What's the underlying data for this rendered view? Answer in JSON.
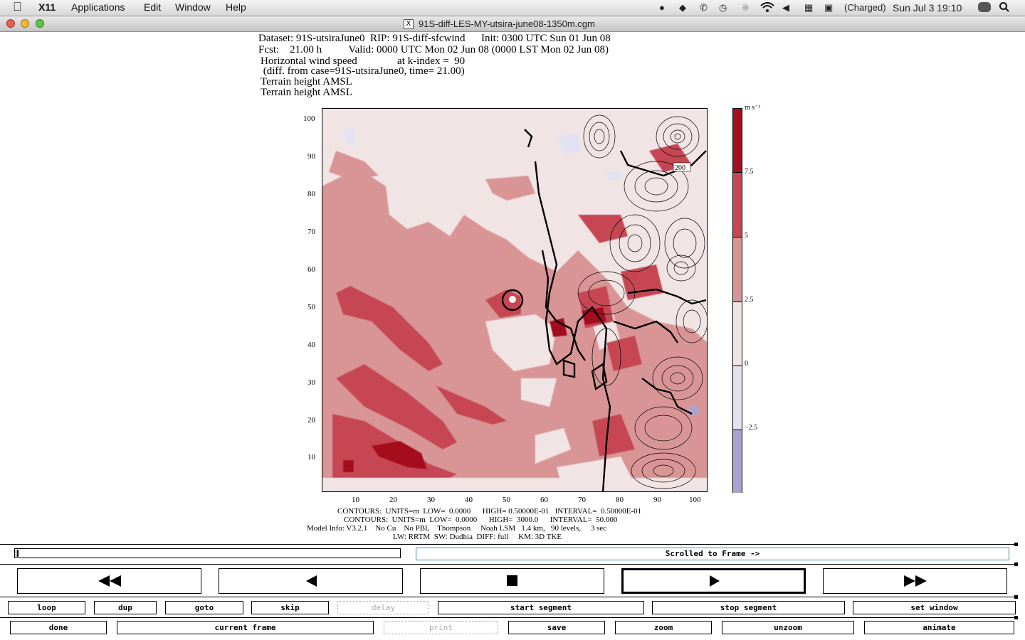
{
  "menubar": {
    "app": "X11",
    "items": [
      "Applications",
      "Edit",
      "Window",
      "Help"
    ],
    "battery": "(Charged)",
    "clock": "Sun Jul 3  19:10"
  },
  "window": {
    "title": "91S-diff-LES-MY-utsira-june08-1350m.cgm"
  },
  "plot": {
    "header_lines": [
      "Dataset: 91S-utsiraJune0  RIP: 91S-diff-sfcwind      Init: 0300 UTC Sun 01 Jun 08",
      "Fcst:    21.00 h          Valid: 0000 UTC Mon 02 Jun 08 (0000 LST Mon 02 Jun 08)",
      "Horizontal wind speed               at k-index =  90",
      " (diff. from case=91S-utsiraJune0, time= 21.00)",
      "Terrain height AMSL",
      "Terrain height AMSL"
    ],
    "y_ticks": [
      "100",
      "90",
      "80",
      "70",
      "60",
      "50",
      "40",
      "30",
      "20",
      "10"
    ],
    "x_ticks": [
      "10",
      "20",
      "30",
      "40",
      "50",
      "60",
      "70",
      "80",
      "90",
      "100"
    ],
    "contour_label": "200",
    "colorbar": {
      "units": "m s⁻¹",
      "labels": [
        "7.5",
        "5",
        "2.5",
        "0",
        "−2.5"
      ],
      "colors": [
        "#a4101e",
        "#c64653",
        "#d99596",
        "#f1e4e4",
        "#e2e2f2",
        "#a9a3d3"
      ]
    },
    "footer_lines": [
      "CONTOURS:  UNITS=m  LOW=  0.0000      HIGH= 0.50000E-01   INTERVAL=  0.50000E-01",
      "CONTOURS:  UNITS=m  LOW=  0.0000      HIGH=  3000.0      INTERVAL=  50.000",
      "Model Info: V3.2.1    No Cu    No PBL    Thompson     Noah LSM   1.4 km,   90 levels,     3 sec",
      "LW: RRTM  SW: Dudhia  DIFF: full     KM: 3D TKE"
    ]
  },
  "controls": {
    "status": "Scrolled to Frame ->",
    "row1": [
      {
        "label": "loop",
        "enabled": true
      },
      {
        "label": "dup",
        "enabled": true
      },
      {
        "label": "goto",
        "enabled": true
      },
      {
        "label": "skip",
        "enabled": true
      },
      {
        "label": "delay",
        "enabled": false
      },
      {
        "label": "start segment",
        "enabled": true
      },
      {
        "label": "stop segment",
        "enabled": true
      },
      {
        "label": "set window",
        "enabled": true
      }
    ],
    "row2": [
      {
        "label": "done",
        "enabled": true
      },
      {
        "label": "current frame",
        "enabled": true
      },
      {
        "label": "print",
        "enabled": false
      },
      {
        "label": "save",
        "enabled": true
      },
      {
        "label": "zoom",
        "enabled": true
      },
      {
        "label": "unzoom",
        "enabled": true
      },
      {
        "label": "animate",
        "enabled": true
      }
    ],
    "transport": [
      "fast-rewind",
      "step-back",
      "stop",
      "play",
      "fast-forward"
    ]
  }
}
